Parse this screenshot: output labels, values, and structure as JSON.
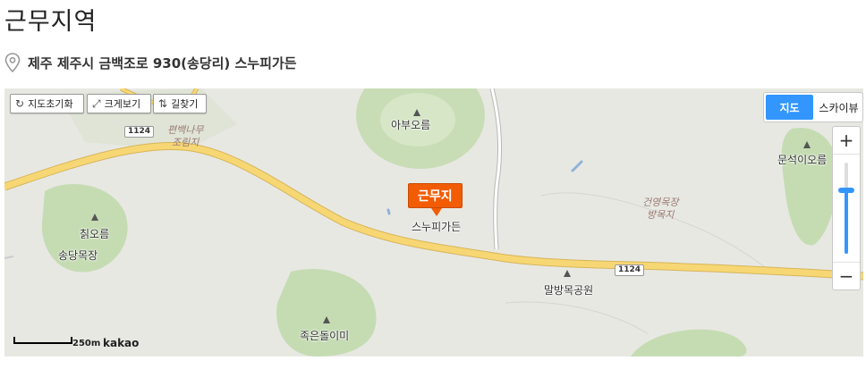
{
  "page": {
    "title": "근무지역",
    "address": "제주 제주시 금백조로 930(송당리) 스누피가든"
  },
  "icons": {
    "address": "map-pin-icon"
  },
  "map": {
    "controls": [
      {
        "label": "지도초기화",
        "icon": "↻"
      },
      {
        "label": "크게보기",
        "icon": "⤢"
      },
      {
        "label": "길찾기",
        "icon": "⇅"
      }
    ],
    "map_types": {
      "map": "지도",
      "skyview": "스카이뷰",
      "active": "지도"
    },
    "zoom": {
      "in": "+",
      "out": "−",
      "level": 0.7
    },
    "marker": {
      "label": "근무지"
    },
    "places": {
      "aburoreum": "아부오름",
      "chikoreum": "칡오름",
      "songdang_ranch": "송당목장",
      "snoopy_garden": "스누피가든",
      "malbang_park": "말방목공원",
      "jokeun_dolmi": "족은돌이미",
      "munseok_oreum": "문석이오름",
      "pyeonbaek_line1": "편백나무",
      "pyeonbaek_line2": "조림지",
      "geonyeong_line1": "건영목장",
      "geonyeong_line2": "방목지"
    },
    "road_number": "1124",
    "scale": "250m",
    "provider": "kakao",
    "colors": {
      "accent": "#3396ff",
      "marker": "#f25c05",
      "road": "#f7d774",
      "forest": "#c5dcb3"
    }
  }
}
